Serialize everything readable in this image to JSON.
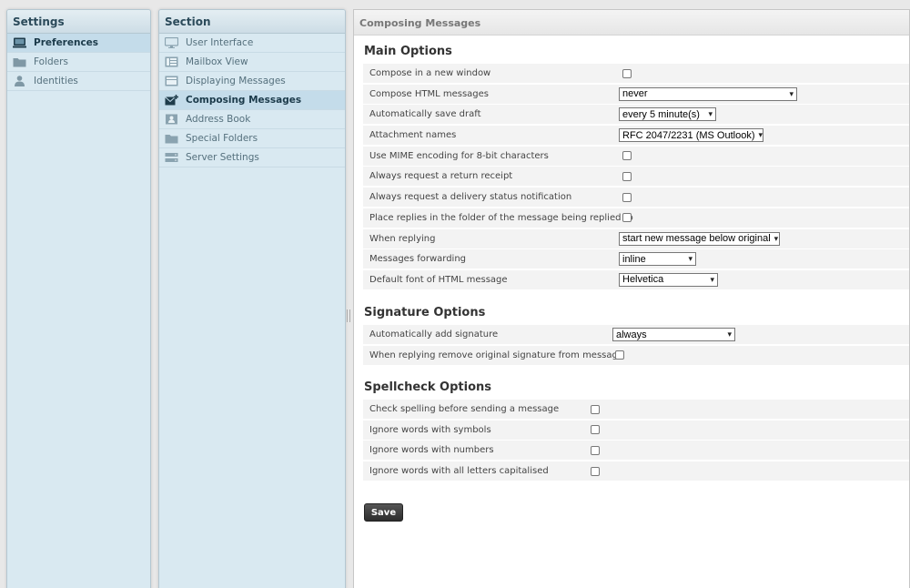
{
  "settings_panel": {
    "title": "Settings",
    "items": [
      {
        "label": "Preferences",
        "icon": "computer-icon",
        "selected": true
      },
      {
        "label": "Folders",
        "icon": "folder-icon",
        "selected": false
      },
      {
        "label": "Identities",
        "icon": "person-icon",
        "selected": false
      }
    ]
  },
  "section_panel": {
    "title": "Section",
    "items": [
      {
        "label": "User Interface",
        "icon": "monitor-icon",
        "selected": false
      },
      {
        "label": "Mailbox View",
        "icon": "mailbox-view-icon",
        "selected": false
      },
      {
        "label": "Displaying Messages",
        "icon": "message-display-icon",
        "selected": false
      },
      {
        "label": "Composing Messages",
        "icon": "compose-mail-icon",
        "selected": true
      },
      {
        "label": "Address Book",
        "icon": "address-book-icon",
        "selected": false
      },
      {
        "label": "Special Folders",
        "icon": "folder-icon",
        "selected": false
      },
      {
        "label": "Server Settings",
        "icon": "server-icon",
        "selected": false
      }
    ]
  },
  "main": {
    "title": "Composing Messages",
    "main_options": {
      "title": "Main Options",
      "rows": [
        {
          "label": "Compose in a new window",
          "type": "checkbox"
        },
        {
          "label": "Compose HTML messages",
          "type": "select",
          "value": "never"
        },
        {
          "label": "Automatically save draft",
          "type": "select",
          "value": "every 5 minute(s)"
        },
        {
          "label": "Attachment names",
          "type": "select",
          "value": "RFC 2047/2231 (MS Outlook)"
        },
        {
          "label": "Use MIME encoding for 8-bit characters",
          "type": "checkbox"
        },
        {
          "label": "Always request a return receipt",
          "type": "checkbox"
        },
        {
          "label": "Always request a delivery status notification",
          "type": "checkbox"
        },
        {
          "label": "Place replies in the folder of the message being replied to",
          "type": "checkbox"
        },
        {
          "label": "When replying",
          "type": "select",
          "value": "start new message below original"
        },
        {
          "label": "Messages forwarding",
          "type": "select",
          "value": "inline"
        },
        {
          "label": "Default font of HTML message",
          "type": "select",
          "value": "Helvetica"
        }
      ]
    },
    "signature_options": {
      "title": "Signature Options",
      "rows": [
        {
          "label": "Automatically add signature",
          "type": "select",
          "value": "always"
        },
        {
          "label": "When replying remove original signature from message",
          "type": "checkbox"
        }
      ]
    },
    "spellcheck_options": {
      "title": "Spellcheck Options",
      "rows": [
        {
          "label": "Check spelling before sending a message",
          "type": "checkbox"
        },
        {
          "label": "Ignore words with symbols",
          "type": "checkbox"
        },
        {
          "label": "Ignore words with numbers",
          "type": "checkbox"
        },
        {
          "label": "Ignore words with all letters capitalised",
          "type": "checkbox"
        }
      ]
    },
    "save_label": "Save"
  }
}
